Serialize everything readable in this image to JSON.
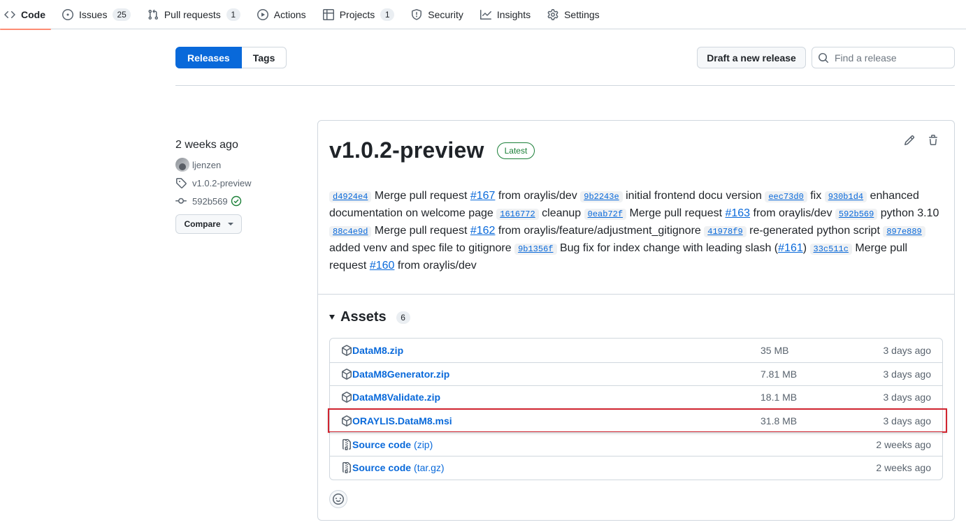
{
  "repo_nav": {
    "items": [
      {
        "label": "Code",
        "icon": "code-icon",
        "selected": true
      },
      {
        "label": "Issues",
        "icon": "issue-opened-icon",
        "count": "25"
      },
      {
        "label": "Pull requests",
        "icon": "git-pull-request-icon",
        "count": "1"
      },
      {
        "label": "Actions",
        "icon": "play-icon"
      },
      {
        "label": "Projects",
        "icon": "table-icon",
        "count": "1"
      },
      {
        "label": "Security",
        "icon": "shield-icon"
      },
      {
        "label": "Insights",
        "icon": "graph-icon"
      },
      {
        "label": "Settings",
        "icon": "gear-icon"
      }
    ]
  },
  "subnav": {
    "releases": "Releases",
    "tags": "Tags"
  },
  "draft_button": "Draft a new release",
  "search": {
    "placeholder": "Find a release",
    "value": ""
  },
  "meta": {
    "when": "2 weeks ago",
    "author": "ljenzen",
    "tag": "v1.0.2-preview",
    "commit": "592b569",
    "compare": "Compare"
  },
  "release": {
    "title": "v1.0.2-preview",
    "badge": "Latest",
    "notes": [
      {
        "sha": "d4924e4",
        "text": "Merge pull request ",
        "link": "#167",
        "after": " from oraylis/dev "
      },
      {
        "sha": "9b2243e",
        "text": "initial frontend docu version "
      },
      {
        "sha": "eec73d0",
        "text": "fix "
      },
      {
        "sha": "930b1d4",
        "text": "enhanced documentation on welcome page "
      },
      {
        "sha": "1616772",
        "text": "cleanup "
      },
      {
        "sha": "0eab72f",
        "text": "Merge pull request ",
        "link": "#163",
        "after": " from oraylis/dev "
      },
      {
        "sha": "592b569",
        "text": "python 3.10 "
      },
      {
        "sha": "88c4e9d",
        "text": "Merge pull request ",
        "link": "#162",
        "after": " from oraylis/feature/adjustment_gitignore "
      },
      {
        "sha": "41978f9",
        "text": "re-generated python script "
      },
      {
        "sha": "897e889",
        "text": "added venv and spec file to gitignore "
      },
      {
        "sha": "9b1356f",
        "text": "Bug fix for index change with leading slash (",
        "link": "#161",
        "after": ") "
      },
      {
        "sha": "33c511c",
        "text": "Merge pull request ",
        "link": "#160",
        "after": " from oraylis/dev"
      }
    ]
  },
  "assets": {
    "heading": "Assets",
    "count": "6",
    "items": [
      {
        "name": "DataM8.zip",
        "size": "35 MB",
        "date": "3 days ago",
        "icon": "package-icon"
      },
      {
        "name": "DataM8Generator.zip",
        "size": "7.81 MB",
        "date": "3 days ago",
        "icon": "package-icon"
      },
      {
        "name": "DataM8Validate.zip",
        "size": "18.1 MB",
        "date": "3 days ago",
        "icon": "package-icon"
      },
      {
        "name": "ORAYLIS.DataM8.msi",
        "size": "31.8 MB",
        "date": "3 days ago",
        "icon": "package-icon",
        "highlighted": true
      },
      {
        "name": "Source code",
        "ext": "(zip)",
        "date": "2 weeks ago",
        "icon": "file-zip-icon"
      },
      {
        "name": "Source code",
        "ext": "(tar.gz)",
        "date": "2 weeks ago",
        "icon": "file-zip-icon"
      }
    ]
  },
  "colors": {
    "accent": "#0969da",
    "success": "#1a7f37",
    "highlight": "#d1242f",
    "nav_underline": "#fd8c73"
  }
}
